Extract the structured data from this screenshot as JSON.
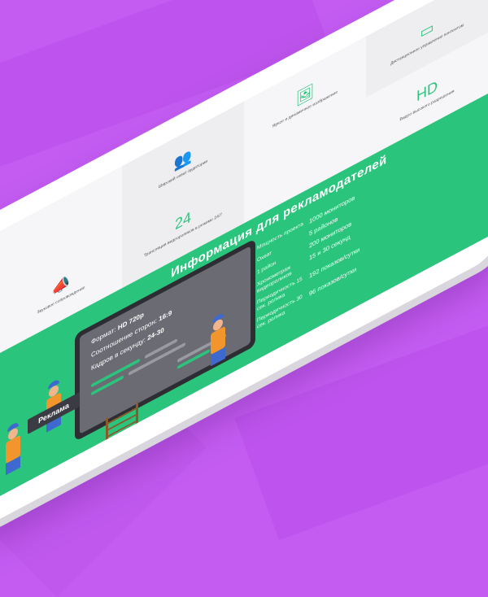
{
  "colors": {
    "background": "#c45cf2",
    "accent": "#2bc47c",
    "board": "#2d2d33",
    "worker_shirt": "#f2952c",
    "worker_pants": "#3e6ad0"
  },
  "features": [
    {
      "icon": "people-icon",
      "glyph": "👥",
      "label": "Широкий охват аудитории"
    },
    {
      "icon": "megaphone-icon",
      "glyph": "📣",
      "label": "Звуковое сопровождение"
    },
    {
      "icon": "image-icon",
      "glyph": "🖼",
      "label": "Яркое и динамичное изображение"
    },
    {
      "icon": "clock-24-icon",
      "glyph": "24",
      "label": "Трансляция видеороликов в режиме 24/7"
    },
    {
      "icon": "monitor-icon",
      "glyph": "▭",
      "label": "Дистанционное управление контентом"
    },
    {
      "icon": "hd-icon",
      "glyph": "HD",
      "label": "Видео высокого разрешения"
    }
  ],
  "banner": {
    "title": "Информация для рекламодателей"
  },
  "board": {
    "format_label": "Формат:",
    "format_value": "HD 720p",
    "ratio_label": "Соотношение сторон:",
    "ratio_value": "16:9",
    "fps_label": "Кадров в секунду:",
    "fps_value": "24-30",
    "sign": "Реклама"
  },
  "stats": [
    {
      "key": "Мощность проекта",
      "values": [
        "1000 мониторов"
      ]
    },
    {
      "key": "Охват",
      "values": [
        "5 районов"
      ]
    },
    {
      "key": "1 район",
      "values": [
        "200 мониторов"
      ]
    },
    {
      "key": "Хронометраж видеороликов",
      "values": [
        "15 и 30 секунд"
      ]
    },
    {
      "key": "Периодичность 15 сек. ролика",
      "values": [
        "192 показов/сутки"
      ]
    },
    {
      "key": "Периодичность 30 сек. ролика",
      "values": [
        "96 показов/сутки"
      ]
    }
  ]
}
